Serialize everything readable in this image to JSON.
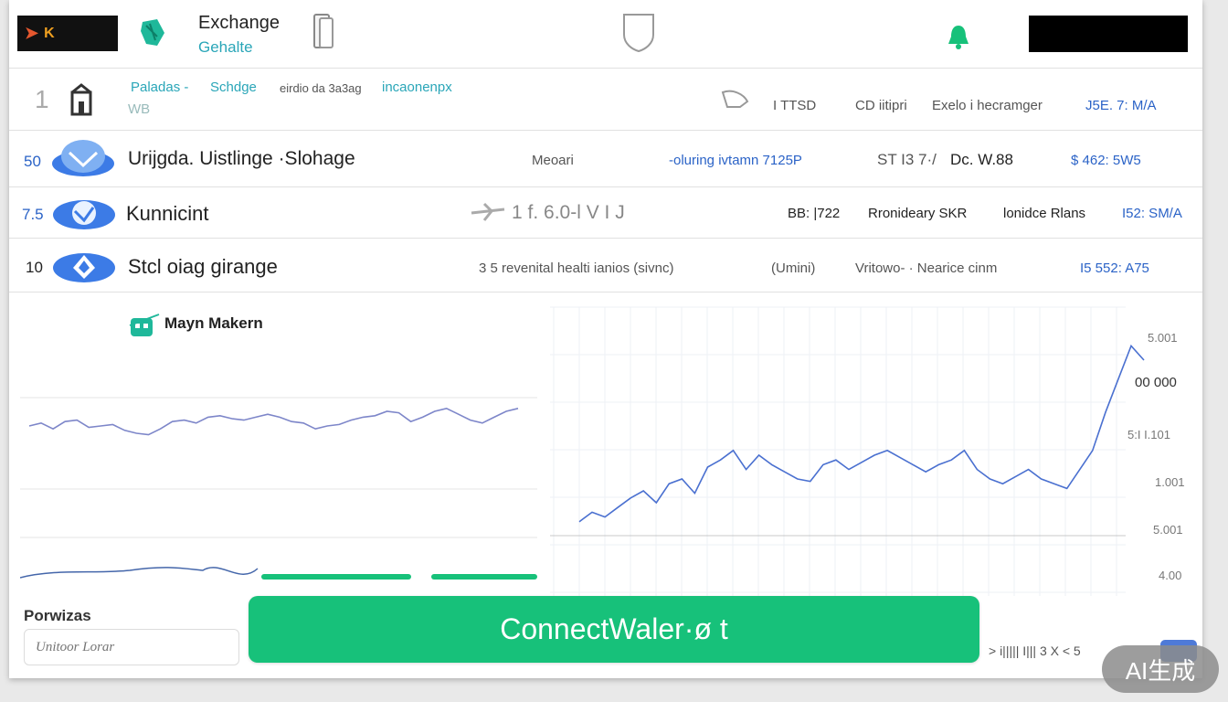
{
  "header": {
    "logo_text": "K",
    "brand_title": "Exchange",
    "brand_subtitle": "Gehalte"
  },
  "table_header": {
    "rank": "1",
    "nav_1": "Paladas -",
    "nav_2": "Schdge",
    "nav_3": "eirdio da 3a3ag",
    "nav_4": "incaonenpx",
    "sub": "WB",
    "col_1": "I TTSD",
    "col_2": "CD iitipri",
    "col_3": "Exelo i hecramger",
    "col_4": "J5E. 7: M/A"
  },
  "rows": [
    {
      "rank": "50",
      "name": "Urijgda. Uistlinge ·Slohage",
      "col_1": "Meoari",
      "col_2": "-oluring ivtamn 7125P",
      "col_3": "ST I3 7·/",
      "col_4": "Dc. W.88",
      "col_5": "$ 462: 5W5"
    },
    {
      "rank": "7.5",
      "name": "Kunnicint",
      "col_1": "1 f. 6.0-l V I J",
      "col_2": "BB: |722",
      "col_3": "Rronideary SKR",
      "col_4": "lonidce Rlans",
      "col_5": "I52: SM/A"
    },
    {
      "rank": "10",
      "name": "Stcl oiag girange",
      "col_1": "3 5 revenital healti ianios  (sivnc)",
      "col_2": "(Umini)",
      "col_3": "Vritowo- · Nearice  cinm",
      "col_5": "I5 552: A75"
    }
  ],
  "left_panel": {
    "title": "Mayn Makern"
  },
  "right_chart": {
    "y_ticks": [
      "5.001",
      "00 000",
      "5:I I.101",
      "1.001",
      "5.001",
      "4.00"
    ]
  },
  "chart_data": {
    "type": "line",
    "series": [
      {
        "values": [
          60,
          62,
          58,
          63,
          64,
          59,
          60,
          61,
          57,
          55,
          54,
          58,
          63,
          64,
          62,
          66,
          67,
          65,
          64,
          66,
          68,
          66,
          63,
          62,
          58,
          60,
          61,
          64,
          66,
          67,
          70,
          69,
          63,
          66,
          70,
          72,
          68,
          64,
          62,
          66,
          70,
          72
        ]
      },
      {
        "values": [
          12,
          16,
          14,
          18,
          22,
          25,
          20,
          28,
          30,
          24,
          35,
          38,
          42,
          34,
          40,
          36,
          33,
          30,
          29,
          36,
          38,
          34,
          37,
          40,
          42,
          39,
          36,
          33,
          36,
          38,
          42,
          34,
          30,
          28,
          31,
          34,
          30,
          28,
          26,
          34,
          42,
          58,
          72,
          86,
          80
        ]
      }
    ]
  },
  "bottom": {
    "label": "Porwizas",
    "input_placeholder": "Unitoor Lorar",
    "connect_button": "ConnectWaler·ø t",
    "pager": "> i|||||  I|||  3 X  < 5"
  },
  "watermark": "AI生成",
  "colors": {
    "accent_green": "#17c17a",
    "accent_blue": "#2b63c7",
    "teal": "#2aa6b8"
  }
}
